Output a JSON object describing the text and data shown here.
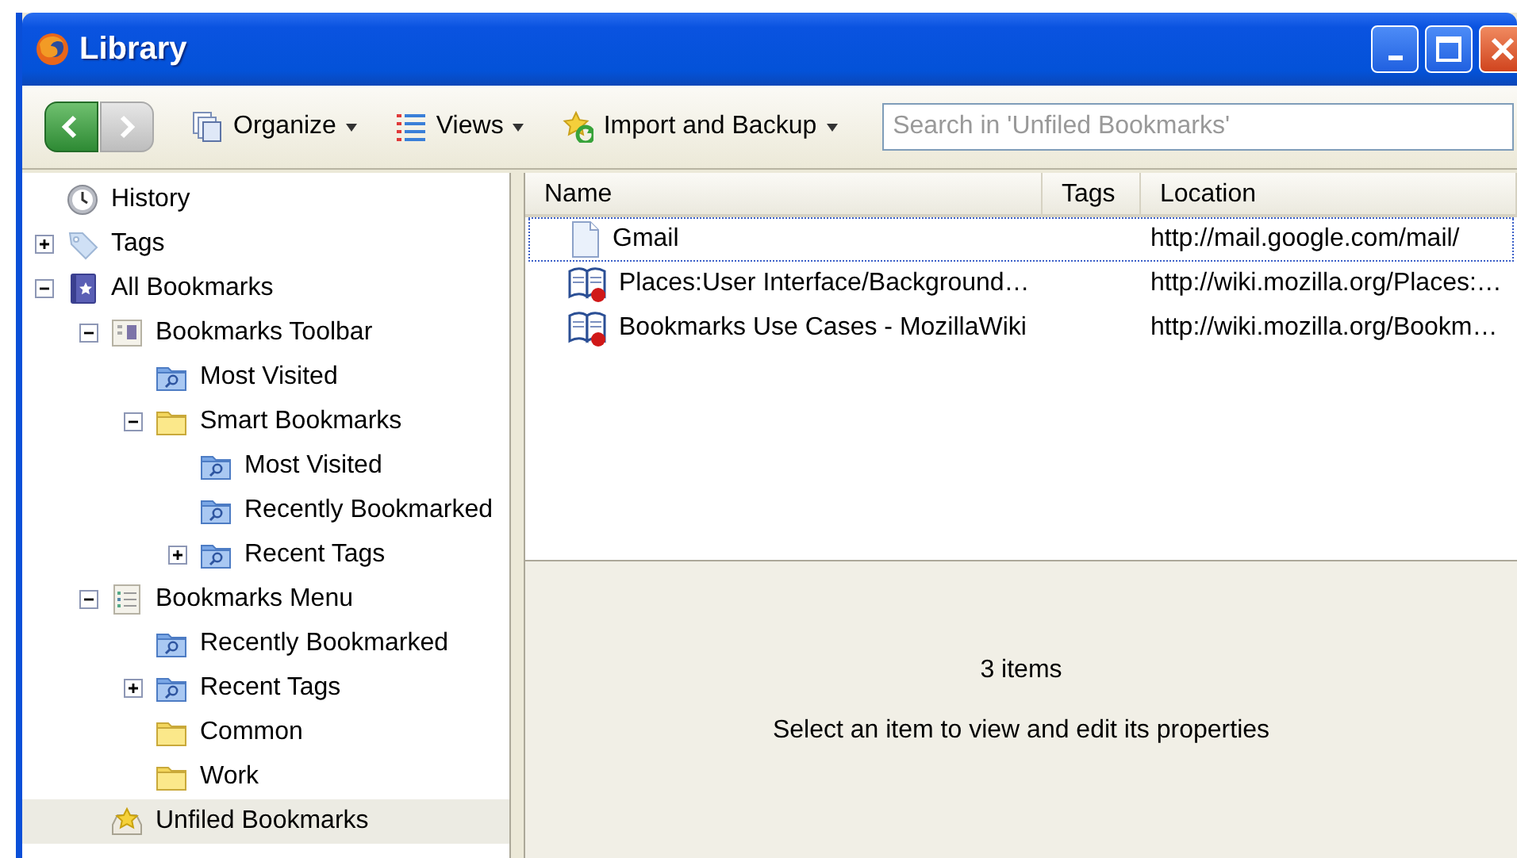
{
  "window": {
    "title": "Library"
  },
  "toolbar": {
    "back": {
      "disabled": false
    },
    "forward": {
      "disabled": true
    },
    "menus": [
      {
        "label": "Organize",
        "kind": "organize"
      },
      {
        "label": "Views",
        "kind": "views"
      },
      {
        "label": "Import and Backup",
        "kind": "import"
      }
    ],
    "search": {
      "placeholder": "Search in 'Unfiled Bookmarks'"
    }
  },
  "sidebar": {
    "items": [
      {
        "label": "History",
        "kind": "history",
        "selected": false
      },
      {
        "label": "Tags",
        "kind": "tag",
        "expanded": false,
        "selected": false
      },
      {
        "label": "All Bookmarks",
        "kind": "all",
        "expanded": true,
        "selected": false,
        "children": [
          {
            "label": "Bookmarks Toolbar",
            "kind": "toolbar",
            "expanded": true,
            "selected": false,
            "children": [
              {
                "label": "Most Visited",
                "kind": "smart",
                "selected": false
              },
              {
                "label": "Smart Bookmarks",
                "kind": "folder",
                "expanded": true,
                "selected": false,
                "children": [
                  {
                    "label": "Most Visited",
                    "kind": "smart",
                    "selected": false
                  },
                  {
                    "label": "Recently Bookmarked",
                    "kind": "smart",
                    "selected": false
                  },
                  {
                    "label": "Recent Tags",
                    "kind": "smart",
                    "expanded": false,
                    "selected": false
                  }
                ]
              }
            ]
          },
          {
            "label": "Bookmarks Menu",
            "kind": "menu",
            "expanded": true,
            "selected": false,
            "children": [
              {
                "label": "Recently Bookmarked",
                "kind": "smart",
                "selected": false
              },
              {
                "label": "Recent Tags",
                "kind": "smart",
                "expanded": false,
                "selected": false
              },
              {
                "label": "Common",
                "kind": "folder",
                "selected": false
              },
              {
                "label": "Work",
                "kind": "folder",
                "selected": false
              }
            ]
          },
          {
            "label": "Unfiled Bookmarks",
            "kind": "unfiled",
            "selected": true
          }
        ]
      }
    ]
  },
  "table": {
    "columns": [
      "Name",
      "Tags",
      "Location"
    ],
    "rows": [
      {
        "kind": "page",
        "name": "Gmail",
        "location": "http://mail.google.com/mail/",
        "focused": true
      },
      {
        "kind": "livemark",
        "name": "Places:User Interface/Background…",
        "location": "http://wiki.mozilla.org/Places:…",
        "focused": false
      },
      {
        "kind": "livemark",
        "name": "Bookmarks Use Cases - MozillaWiki",
        "location": "http://wiki.mozilla.org/Bookm…",
        "focused": false
      }
    ]
  },
  "details": {
    "count": "3 items",
    "hint": "Select an item to view and edit its properties"
  }
}
